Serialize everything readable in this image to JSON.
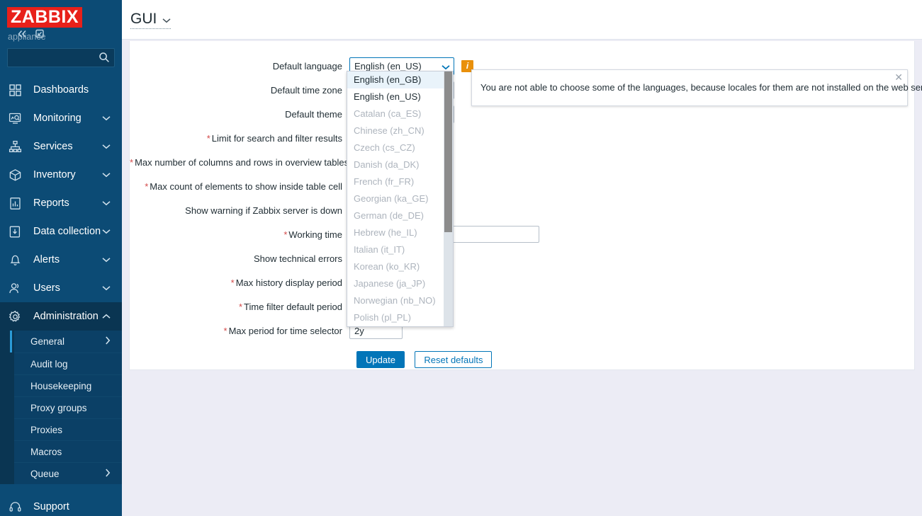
{
  "sidebar": {
    "logo_text": "ZABBIX",
    "logo_color": "#e8201a",
    "appliance_label": "appliance",
    "collapse_icon": "chevron-double-left-icon",
    "compact_icon": "collapse-panel-icon",
    "search": {
      "value": "",
      "placeholder": ""
    },
    "items": [
      {
        "label": "Dashboards",
        "icon": "dashboards-icon",
        "has_chevron": false,
        "expanded": false
      },
      {
        "label": "Monitoring",
        "icon": "monitoring-icon",
        "has_chevron": true,
        "expanded": false
      },
      {
        "label": "Services",
        "icon": "services-icon",
        "has_chevron": true,
        "expanded": false
      },
      {
        "label": "Inventory",
        "icon": "inventory-icon",
        "has_chevron": true,
        "expanded": false
      },
      {
        "label": "Reports",
        "icon": "reports-icon",
        "has_chevron": true,
        "expanded": false
      },
      {
        "label": "Data collection",
        "icon": "data-collection-icon",
        "has_chevron": true,
        "expanded": false
      },
      {
        "label": "Alerts",
        "icon": "alerts-icon",
        "has_chevron": true,
        "expanded": false
      },
      {
        "label": "Users",
        "icon": "users-icon",
        "has_chevron": true,
        "expanded": false
      },
      {
        "label": "Administration",
        "icon": "administration-icon",
        "has_chevron": true,
        "expanded": true
      }
    ],
    "submenu": [
      {
        "label": "General",
        "has_chevron": true,
        "selected": true
      },
      {
        "label": "Audit log",
        "has_chevron": false,
        "selected": false
      },
      {
        "label": "Housekeeping",
        "has_chevron": false,
        "selected": false
      },
      {
        "label": "Proxy groups",
        "has_chevron": false,
        "selected": false
      },
      {
        "label": "Proxies",
        "has_chevron": false,
        "selected": false
      },
      {
        "label": "Macros",
        "has_chevron": false,
        "selected": false
      },
      {
        "label": "Queue",
        "has_chevron": true,
        "selected": false
      }
    ],
    "support": {
      "label": "Support",
      "icon": "headset-icon"
    }
  },
  "header": {
    "title": "GUI",
    "title_chevron": "chevron-down-icon"
  },
  "form": {
    "rows": [
      {
        "label": "Default language",
        "required": false,
        "type": "select",
        "value": "English (en_US)"
      },
      {
        "label": "Default time zone",
        "required": false,
        "type": "select",
        "value": ""
      },
      {
        "label": "Default theme",
        "required": false,
        "type": "select",
        "value": ""
      },
      {
        "label": "Limit for search and filter results",
        "required": true,
        "type": "text",
        "value": ""
      },
      {
        "label": "Max number of columns and rows in overview tables",
        "required": true,
        "type": "text",
        "value": ""
      },
      {
        "label": "Max count of elements to show inside table cell",
        "required": true,
        "type": "text",
        "value": ""
      },
      {
        "label": "Show warning if Zabbix server is down",
        "required": false,
        "type": "checkbox",
        "value": ""
      },
      {
        "label": "Working time",
        "required": true,
        "type": "text-wide",
        "value": ""
      },
      {
        "label": "Show technical errors",
        "required": false,
        "type": "checkbox",
        "value": ""
      },
      {
        "label": "Max history display period",
        "required": true,
        "type": "text",
        "value": ""
      },
      {
        "label": "Time filter default period",
        "required": true,
        "type": "text",
        "value": ""
      },
      {
        "label": "Max period for time selector",
        "required": true,
        "type": "text",
        "value": "2y"
      }
    ],
    "info_icon": "info-icon",
    "info_icon_color": "#e9900b",
    "update_button": "Update",
    "reset_button": "Reset defaults"
  },
  "language_dropdown": {
    "options": [
      {
        "label": "English (en_GB)",
        "disabled": false,
        "highlighted": true
      },
      {
        "label": "English (en_US)",
        "disabled": false,
        "highlighted": false
      },
      {
        "label": "Catalan (ca_ES)",
        "disabled": true,
        "highlighted": false
      },
      {
        "label": "Chinese (zh_CN)",
        "disabled": true,
        "highlighted": false
      },
      {
        "label": "Czech (cs_CZ)",
        "disabled": true,
        "highlighted": false
      },
      {
        "label": "Danish (da_DK)",
        "disabled": true,
        "highlighted": false
      },
      {
        "label": "French (fr_FR)",
        "disabled": true,
        "highlighted": false
      },
      {
        "label": "Georgian (ka_GE)",
        "disabled": true,
        "highlighted": false
      },
      {
        "label": "German (de_DE)",
        "disabled": true,
        "highlighted": false
      },
      {
        "label": "Hebrew (he_IL)",
        "disabled": true,
        "highlighted": false
      },
      {
        "label": "Italian (it_IT)",
        "disabled": true,
        "highlighted": false
      },
      {
        "label": "Korean (ko_KR)",
        "disabled": true,
        "highlighted": false
      },
      {
        "label": "Japanese (ja_JP)",
        "disabled": true,
        "highlighted": false
      },
      {
        "label": "Norwegian (nb_NO)",
        "disabled": true,
        "highlighted": false
      },
      {
        "label": "Polish (pl_PL)",
        "disabled": true,
        "highlighted": false
      }
    ]
  },
  "tooltip": {
    "text": "You are not able to choose some of the languages, because locales for them are not installed on the web server.",
    "close_icon": "close-icon"
  }
}
